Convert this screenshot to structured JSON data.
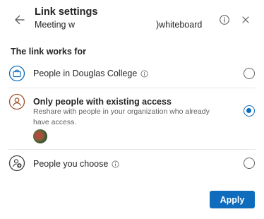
{
  "header": {
    "title": "Link settings",
    "subtitle_left": "Meeting w",
    "subtitle_right": ")whiteboard"
  },
  "section": {
    "label": "The link works for"
  },
  "options": [
    {
      "label": "People in Douglas College",
      "selected": false,
      "icon": "briefcase-icon"
    },
    {
      "label": "Only people with existing access",
      "description": "Reshare with people in your organization who already have access.",
      "selected": true,
      "icon": "person-circle-icon"
    },
    {
      "label": "People you choose",
      "selected": false,
      "icon": "people-choose-icon"
    }
  ],
  "actions": {
    "apply_label": "Apply"
  },
  "colors": {
    "accent": "#0f6cbd",
    "text": "#242424",
    "secondary_text": "#616161",
    "divider": "#e5e5e5",
    "icon_blue": "#0f6cbd",
    "icon_brown": "#a0522d"
  }
}
